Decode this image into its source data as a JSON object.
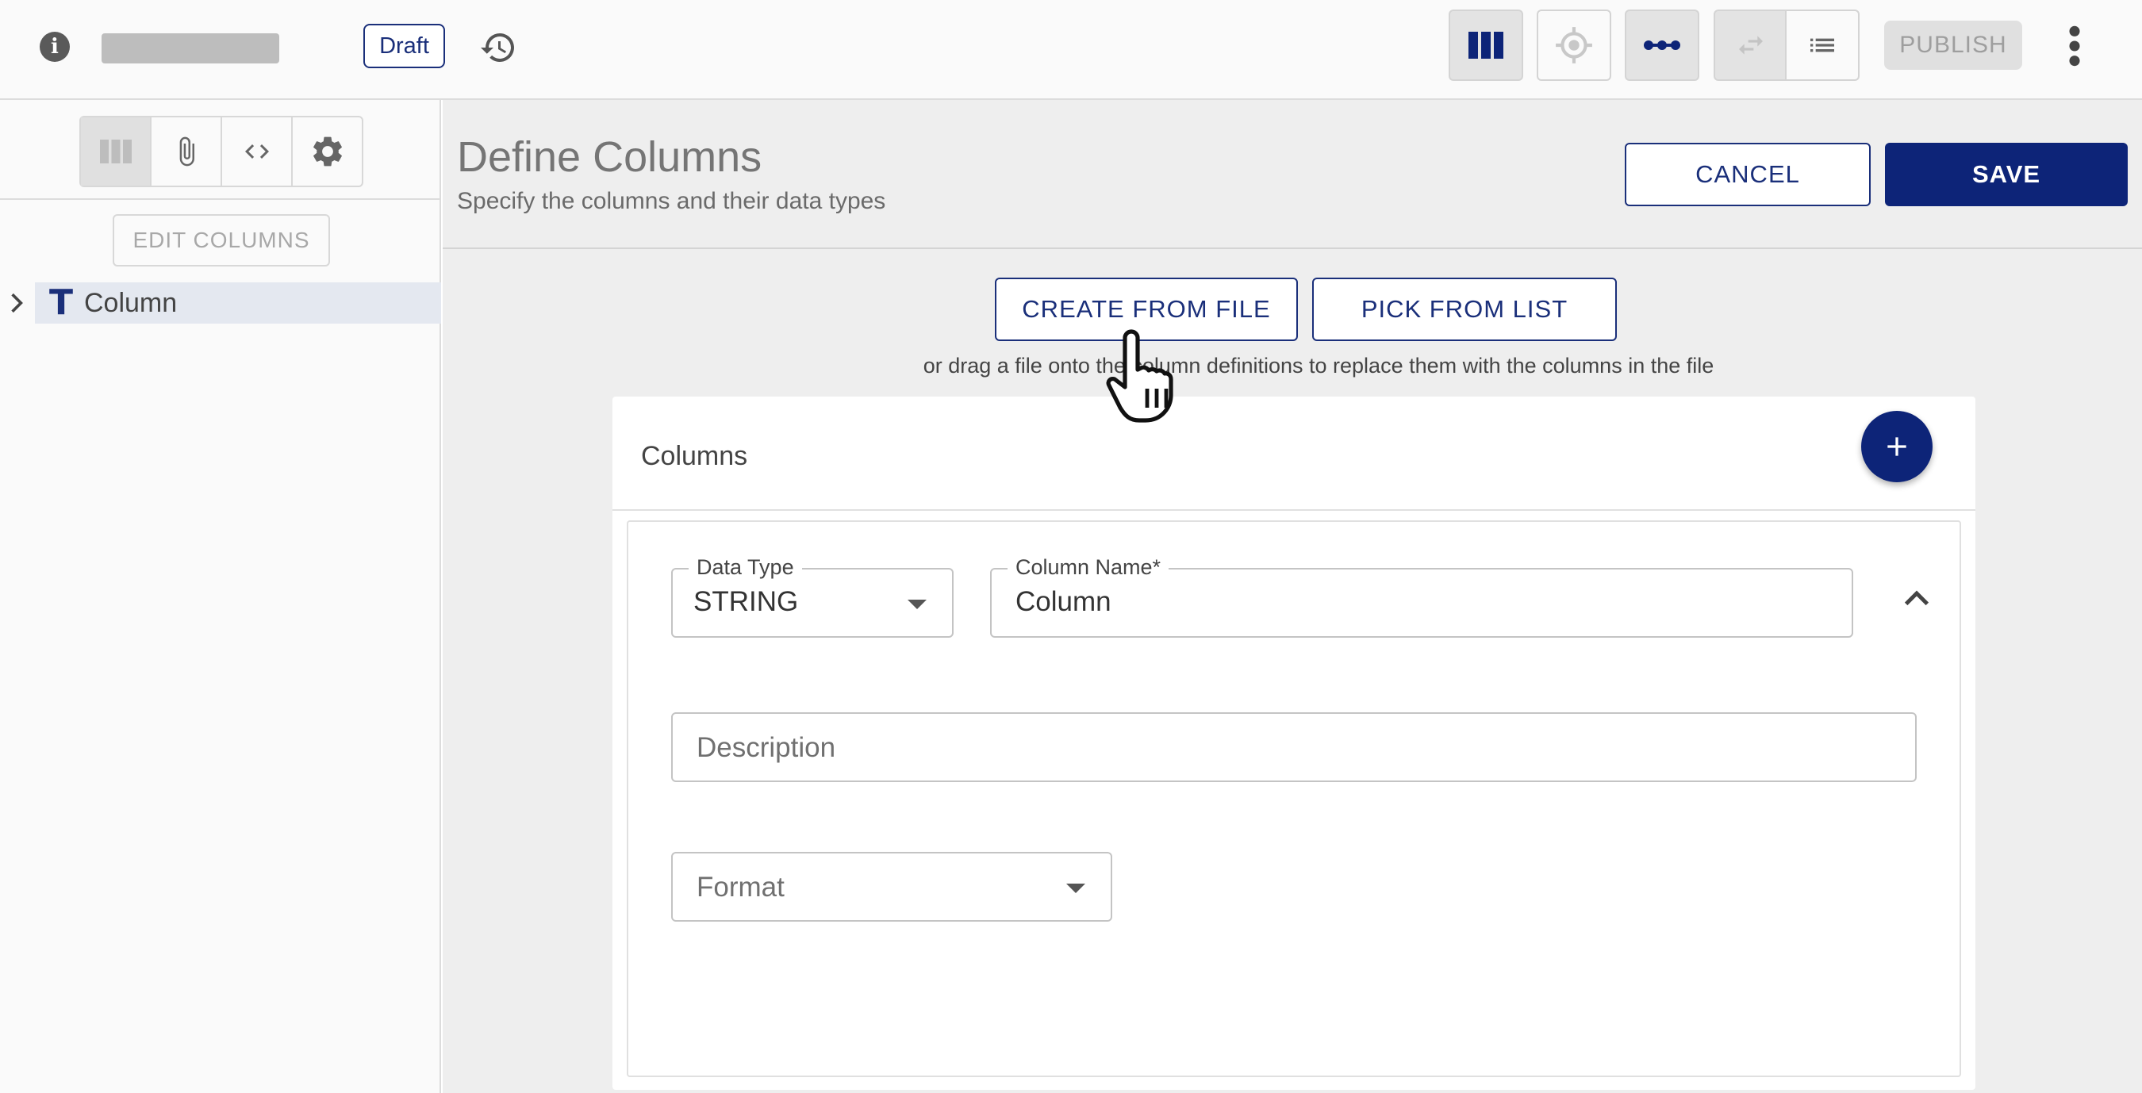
{
  "topbar": {
    "draft_label": "Draft",
    "publish_label": "PUBLISH",
    "icons": [
      "info-icon",
      "history-icon",
      "columns-view-icon",
      "target-icon",
      "connect-icon",
      "swap-icon",
      "list-icon",
      "more-vert-icon"
    ]
  },
  "sidebar": {
    "tabs": [
      "columns-icon",
      "attachment-icon",
      "code-icon",
      "settings-icon"
    ],
    "edit_columns_label": "EDIT COLUMNS",
    "tree": [
      {
        "type_icon": "T",
        "label": "Column"
      }
    ]
  },
  "main": {
    "title": "Define Columns",
    "subtitle": "Specify the columns and their data types",
    "cancel_label": "CANCEL",
    "save_label": "SAVE",
    "create_from_file_label": "CREATE FROM FILE",
    "pick_from_list_label": "PICK FROM LIST",
    "drag_hint": "or drag a file onto the column definitions to replace them with the columns in the file",
    "columns_card": {
      "title": "Columns",
      "item": {
        "data_type_label": "Data Type",
        "data_type_value": "STRING",
        "column_name_label": "Column Name*",
        "column_name_value": "Column",
        "description_placeholder": "Description",
        "format_placeholder": "Format"
      }
    }
  },
  "colors": {
    "primary": "#0d2478",
    "accent_border": "#1a2f7a",
    "main_bg": "#eeeeee",
    "sidebar_bg": "#fafafa",
    "selected_row": "#e4e8f0"
  }
}
